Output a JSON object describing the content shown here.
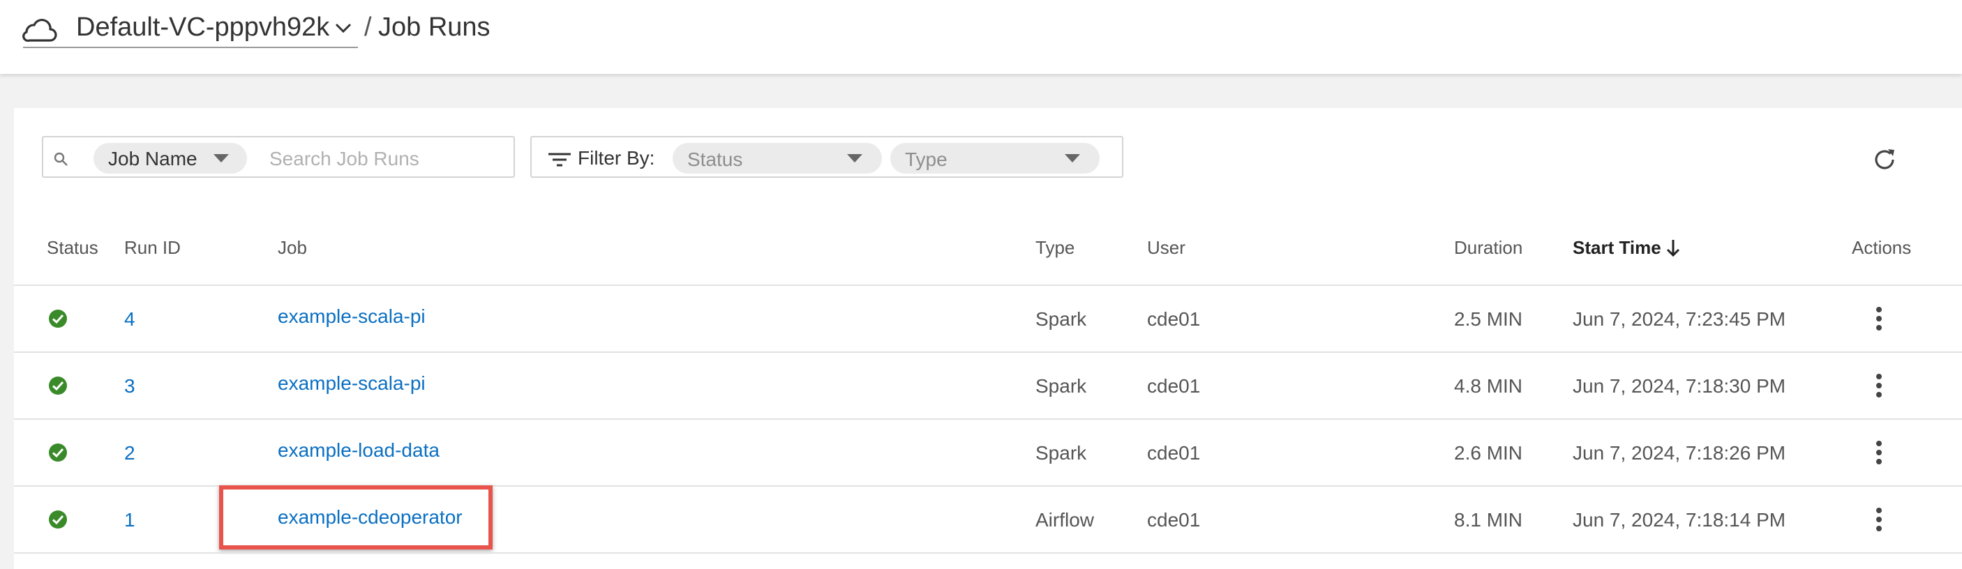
{
  "header": {
    "vc_name": "Default-VC-pppvh92k",
    "separator": "/",
    "title": "Job Runs"
  },
  "search": {
    "field_chip": "Job Name",
    "placeholder": "Search Job Runs"
  },
  "filter": {
    "label": "Filter By:",
    "status_placeholder": "Status",
    "type_placeholder": "Type"
  },
  "table": {
    "columns": {
      "status": "Status",
      "run_id": "Run ID",
      "job": "Job",
      "type": "Type",
      "user": "User",
      "duration": "Duration",
      "start_time": "Start Time",
      "actions": "Actions"
    },
    "sort": {
      "column": "start_time",
      "direction": "descending"
    },
    "rows": [
      {
        "status": "succeeded",
        "run_id": "4",
        "job": "example-scala-pi",
        "type": "Spark",
        "user": "cde01",
        "duration": "2.5 MIN",
        "start_time": "Jun 7, 2024, 7:23:45 PM"
      },
      {
        "status": "succeeded",
        "run_id": "3",
        "job": "example-scala-pi",
        "type": "Spark",
        "user": "cde01",
        "duration": "4.8 MIN",
        "start_time": "Jun 7, 2024, 7:18:30 PM"
      },
      {
        "status": "succeeded",
        "run_id": "2",
        "job": "example-load-data",
        "type": "Spark",
        "user": "cde01",
        "duration": "2.6 MIN",
        "start_time": "Jun 7, 2024, 7:18:26 PM"
      },
      {
        "status": "succeeded",
        "run_id": "1",
        "job": "example-cdeoperator",
        "type": "Airflow",
        "user": "cde01",
        "duration": "8.1 MIN",
        "start_time": "Jun 7, 2024, 7:18:14 PM"
      }
    ]
  },
  "icons": {
    "brand": "cloud-icon",
    "vc_dropdown": "chevron-down-icon",
    "search": "search-icon",
    "filter": "filter-icon",
    "refresh": "refresh-icon",
    "sort": "arrow-down-icon",
    "status": "check-circle-icon",
    "actions": "kebab-menu-icon"
  },
  "colors": {
    "link": "#0a6fc2",
    "success": "#3a8a2a",
    "highlight": "#e8534b"
  },
  "highlighted_row": "example-cdeoperator"
}
